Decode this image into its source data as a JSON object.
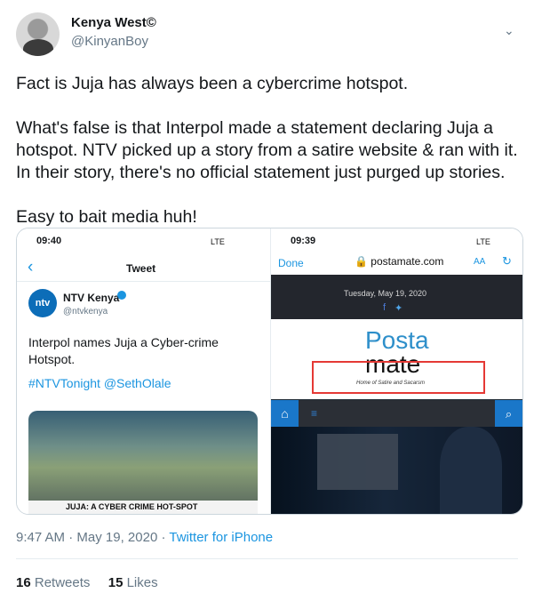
{
  "tweet": {
    "user": {
      "display_name": "Kenya West©",
      "handle": "@KinyanBoy"
    },
    "text": "Fact is Juja has always been a cybercrime hotspot.\n\nWhat's false is that Interpol made a statement declaring Juja a hotspot. NTV picked up a story from a satire website & ran with it. In their story, there's no official statement just purged up stories.\n\nEasy to bait media huh!",
    "footer": {
      "time": "9:47 AM",
      "date": "May 19, 2020",
      "separator": "·",
      "source": "Twitter for iPhone"
    },
    "stats": {
      "retweets": "16",
      "retweets_label": "Retweets",
      "likes": "15",
      "likes_label": "Likes"
    },
    "menu_icon": "chevron-down-icon"
  },
  "screenshot_left": {
    "status_time": "09:40",
    "status_right": "LTE",
    "back_icon": "chevron-left-icon",
    "header": "Tweet",
    "account": {
      "name": "NTV Kenya",
      "handle": "@ntvkenya",
      "logo": "ntv"
    },
    "tweet_text": "Interpol names Juja a Cyber-crime Hotspot.",
    "hashtags": "#NTVTonight @SethOlale",
    "ticker": "JUJA: A CYBER CRIME HOT-SPOT"
  },
  "screenshot_right": {
    "status_time": "09:39",
    "status_right": "LTE",
    "done_label": "Done",
    "address": "postamate.com",
    "aa_label": "AA",
    "date": "Tuesday, May 19, 2020",
    "brand_top": "Posta",
    "brand_bottom": "mate",
    "tagline": "Home of Satire and Sacarsm"
  },
  "colors": {
    "accent": "#1b95e0",
    "muted": "#657786",
    "border": "#ccd6dd"
  }
}
